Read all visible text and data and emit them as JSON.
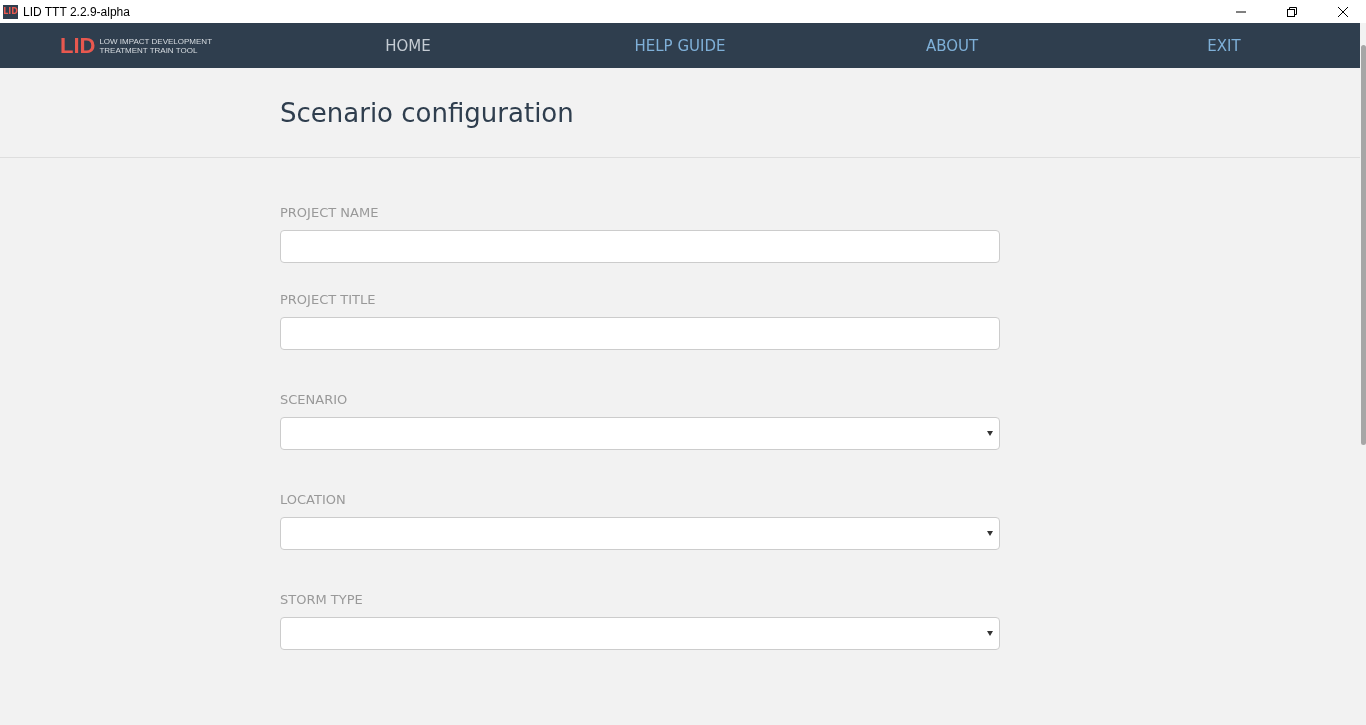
{
  "window": {
    "title": "LID TTT 2.2.9-alpha",
    "icon_text": "LID"
  },
  "logo": {
    "mark": "LID",
    "line_1": "LOW IMPACT DEVELOPMENT",
    "line_2": "TREATMENT TRAIN TOOL"
  },
  "nav": [
    {
      "label": "HOME",
      "selected": true
    },
    {
      "label": "HELP GUIDE",
      "selected": false
    },
    {
      "label": "ABOUT",
      "selected": false
    },
    {
      "label": "EXIT",
      "selected": false
    }
  ],
  "page_title": "Scenario configuration",
  "fields": [
    {
      "label": "PROJECT NAME",
      "kind": "text"
    },
    {
      "label": "PROJECT TITLE",
      "kind": "text"
    },
    {
      "label": "SCENARIO",
      "kind": "select"
    },
    {
      "label": "LOCATION",
      "kind": "select"
    },
    {
      "label": "STORM TYPE",
      "kind": "select"
    }
  ]
}
